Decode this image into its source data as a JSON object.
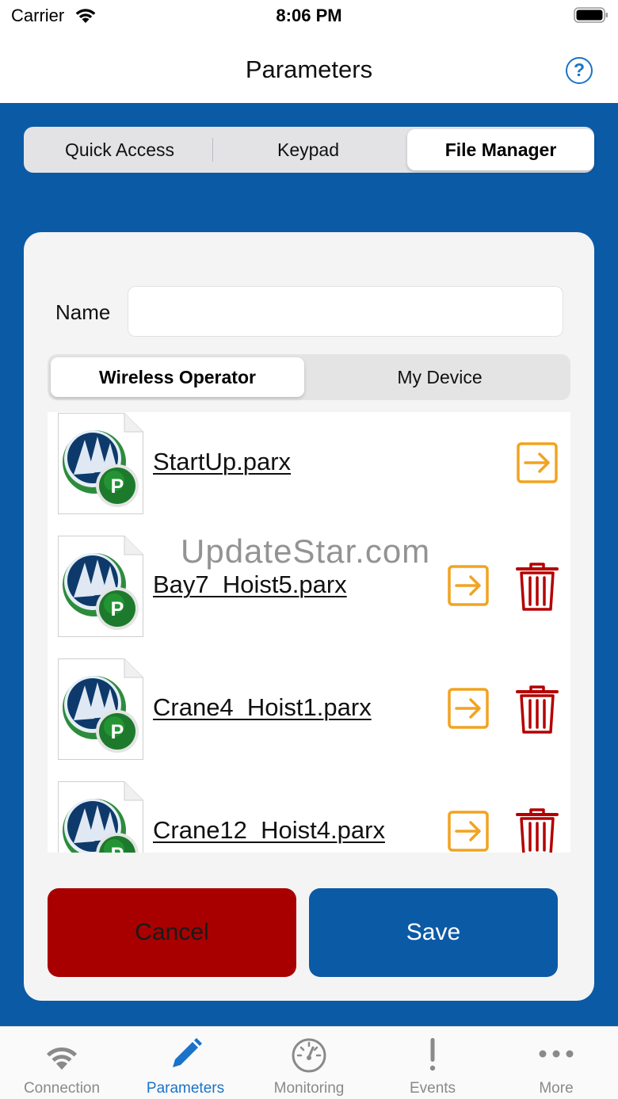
{
  "status_bar": {
    "carrier": "Carrier",
    "time": "8:06 PM"
  },
  "nav": {
    "title": "Parameters",
    "help_icon": "question-circle-icon",
    "help_label": "?"
  },
  "top_segments": [
    {
      "label": "Quick Access",
      "selected": false
    },
    {
      "label": "Keypad",
      "selected": false
    },
    {
      "label": "File Manager",
      "selected": true
    }
  ],
  "form": {
    "name_label": "Name",
    "name_value": "",
    "name_placeholder": ""
  },
  "source_segments": [
    {
      "label": "Wireless Operator",
      "selected": true
    },
    {
      "label": "My Device",
      "selected": false
    }
  ],
  "files": [
    {
      "name": "StartUp.parx",
      "deletable": false,
      "badge": "P"
    },
    {
      "name": "Bay7_Hoist5.parx",
      "deletable": true,
      "badge": "P"
    },
    {
      "name": "Crane4_Hoist1.parx",
      "deletable": true,
      "badge": "P"
    },
    {
      "name": "Crane12_Hoist4.parx",
      "deletable": true,
      "badge": "P"
    }
  ],
  "watermark": "UpdateStar.com",
  "buttons": {
    "cancel": "Cancel",
    "save": "Save"
  },
  "tabs": [
    {
      "label": "Connection",
      "icon": "wifi-icon",
      "active": false
    },
    {
      "label": "Parameters",
      "icon": "pencil-icon",
      "active": true
    },
    {
      "label": "Monitoring",
      "icon": "gauge-icon",
      "active": false
    },
    {
      "label": "Events",
      "icon": "exclamation-icon",
      "active": false
    },
    {
      "label": "More",
      "icon": "more-dots-icon",
      "active": false
    }
  ],
  "colors": {
    "header_blue": "#0b5aa6",
    "cancel_red": "#a80000",
    "open_orange": "#f2a320",
    "delete_red": "#b40000",
    "tab_active": "#1a73c8",
    "tab_inactive": "#8a8a8a"
  }
}
